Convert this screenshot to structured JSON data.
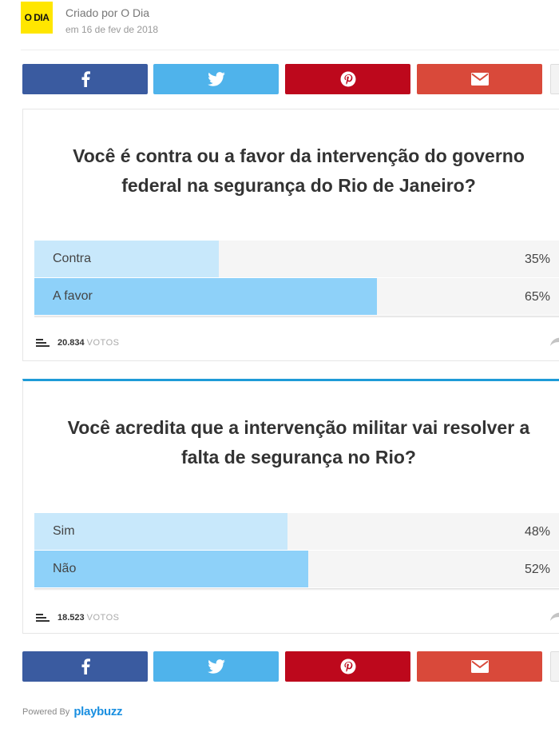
{
  "header": {
    "logo_text": "O DIA",
    "logo_color": "#ffe600",
    "created_by": "Criado por O Dia",
    "date": "em 16 de fev de 2018"
  },
  "share": {
    "icons": [
      "facebook-icon",
      "twitter-icon",
      "pinterest-icon",
      "email-icon"
    ],
    "colors": {
      "facebook": "#3a5ba0",
      "twitter": "#4fb3eb",
      "pinterest": "#bd081c",
      "email": "#d9493a"
    }
  },
  "polls": [
    {
      "question_line1": "Você é contra ou a favor da intervenção do governo",
      "question_line2": "federal na segurança do Rio de Janeiro?",
      "answers": [
        {
          "label": "Contra",
          "percent_text": "35%",
          "percent": 35
        },
        {
          "label": "A favor",
          "percent_text": "65%",
          "percent": 65
        }
      ],
      "votes_count": "20.834",
      "votes_label": "VOTOS"
    },
    {
      "question_line1": "Você acredita que a intervenção militar vai resolver a",
      "question_line2": "falta de segurança no Rio?",
      "answers": [
        {
          "label": "Sim",
          "percent_text": "48%",
          "percent": 48
        },
        {
          "label": "Não",
          "percent_text": "52%",
          "percent": 52
        }
      ],
      "votes_count": "18.523",
      "votes_label": "VOTOS"
    }
  ],
  "footer": {
    "powered_by": "Powered By",
    "brand": "playbuzz",
    "brand_color": "#1a8fe0"
  }
}
